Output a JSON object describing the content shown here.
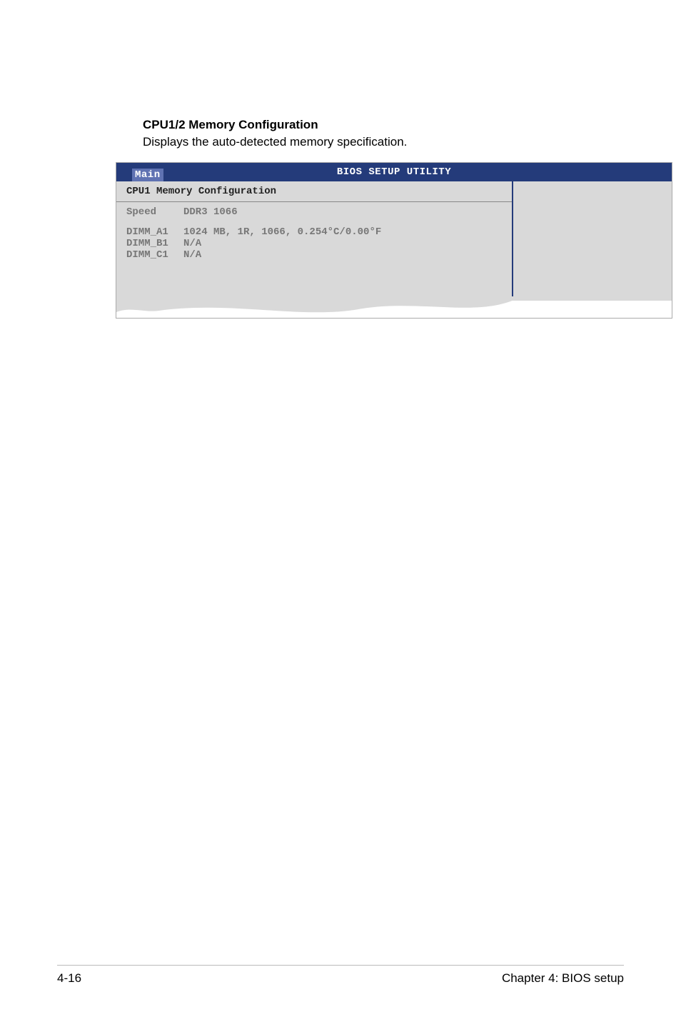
{
  "heading": "CPU1/2 Memory Configuration",
  "description": "Displays the auto-detected memory specification.",
  "bios": {
    "title": "BIOS SETUP UTILITY",
    "tab": "Main",
    "section": "CPU1 Memory Configuration",
    "rows": {
      "speed_label": "Speed",
      "speed_value": "DDR3 1066",
      "dimm_a1_label": "DIMM_A1",
      "dimm_a1_value": "1024 MB, 1R, 1066, 0.254°C/0.00°F",
      "dimm_b1_label": "DIMM_B1",
      "dimm_b1_value": "N/A",
      "dimm_c1_label": "DIMM_C1",
      "dimm_c1_value": "N/A"
    }
  },
  "footer": {
    "left": "4-16",
    "right": "Chapter 4: BIOS setup"
  }
}
